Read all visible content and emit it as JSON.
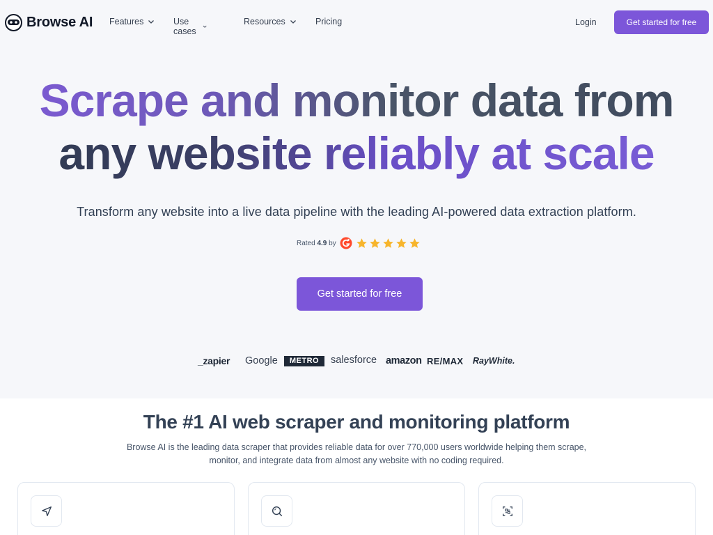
{
  "brand": {
    "name": "Browse AI",
    "accent": "#7c56d9"
  },
  "nav": {
    "items": [
      {
        "label": "Features",
        "has_dropdown": true
      },
      {
        "label": "Use cases",
        "has_dropdown": true
      },
      {
        "label": "Resources",
        "has_dropdown": true
      },
      {
        "label": "Pricing",
        "has_dropdown": false
      }
    ],
    "login": "Login",
    "cta": "Get started for free"
  },
  "hero": {
    "headline_line1": "Scrape and monitor data from",
    "headline_line2": "any website reliably at scale",
    "subheadline": "Transform any website into a live data pipeline with the leading AI-powered data extraction platform.",
    "rating_prefix": "Rated",
    "rating_value": "4.9",
    "rating_suffix": "by",
    "rating_stars": 5,
    "cta": "Get started for free"
  },
  "brands": [
    "_zapier",
    "Google",
    "METRO",
    "salesforce",
    "amazon",
    "RE/MAX",
    "RayWhite."
  ],
  "section": {
    "title": "The #1 AI web scraper and monitoring platform",
    "description": "Browse AI is the leading data scraper that provides reliable data for over 770,000 users worldwide helping them scrape, monitor, and integrate data from almost any website with no coding required."
  },
  "cards": [
    {
      "icon": "send-icon"
    },
    {
      "icon": "search-icon"
    },
    {
      "icon": "scan-icon"
    }
  ]
}
